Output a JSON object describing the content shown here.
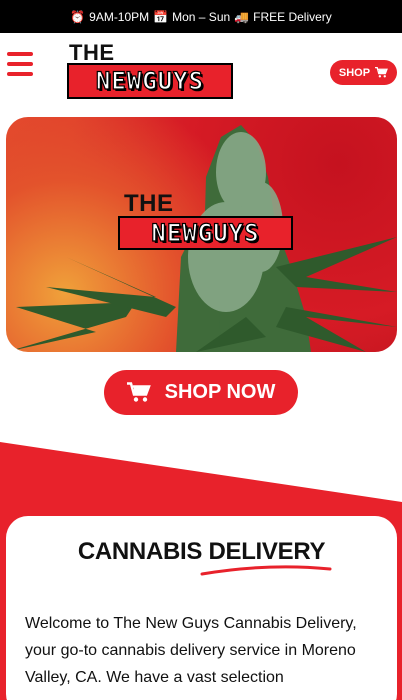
{
  "topbar": {
    "hours_icon": "alarm-clock-icon",
    "hours": "9AM-10PM",
    "days_icon": "calendar-icon",
    "days": "Mon – Sun",
    "delivery_icon": "delivery-truck-icon",
    "delivery": "FREE Delivery"
  },
  "header": {
    "menu_icon": "hamburger-menu-icon",
    "logo_the": "THE",
    "logo_name": "NEWGUYS",
    "shop_label": "SHOP",
    "shop_icon": "cart-icon"
  },
  "hero": {
    "logo_the": "THE",
    "logo_name": "NEWGUYS"
  },
  "cta": {
    "label": "SHOP NOW",
    "icon": "cart-icon"
  },
  "section": {
    "title": "CANNABIS DELIVERY",
    "intro": "Welcome to The New Guys Cannabis Delivery, your go-to cannabis delivery service in Moreno Valley, CA. We have a vast selection"
  },
  "colors": {
    "brand_red": "#e8222b",
    "topbar_bg": "#000000",
    "text": "#111111"
  }
}
